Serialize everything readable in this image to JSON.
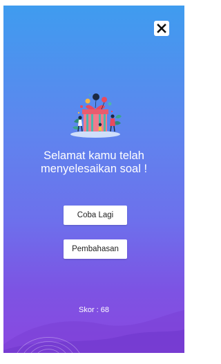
{
  "dialog": {
    "close_icon": "close-icon",
    "illustration_icon": "gift-celebration-illustration",
    "message_line1": "Selamat kamu telah",
    "message_line2": "menyelesaikan soal !",
    "retry_label": "Coba Lagi",
    "review_label": "Pembahasan",
    "score_text": "Skor : 68"
  },
  "colors": {
    "gradient_top": "#3f9cef",
    "gradient_bottom": "#8a48e0",
    "button_bg": "#ffffff",
    "text_light": "#ffffff"
  }
}
